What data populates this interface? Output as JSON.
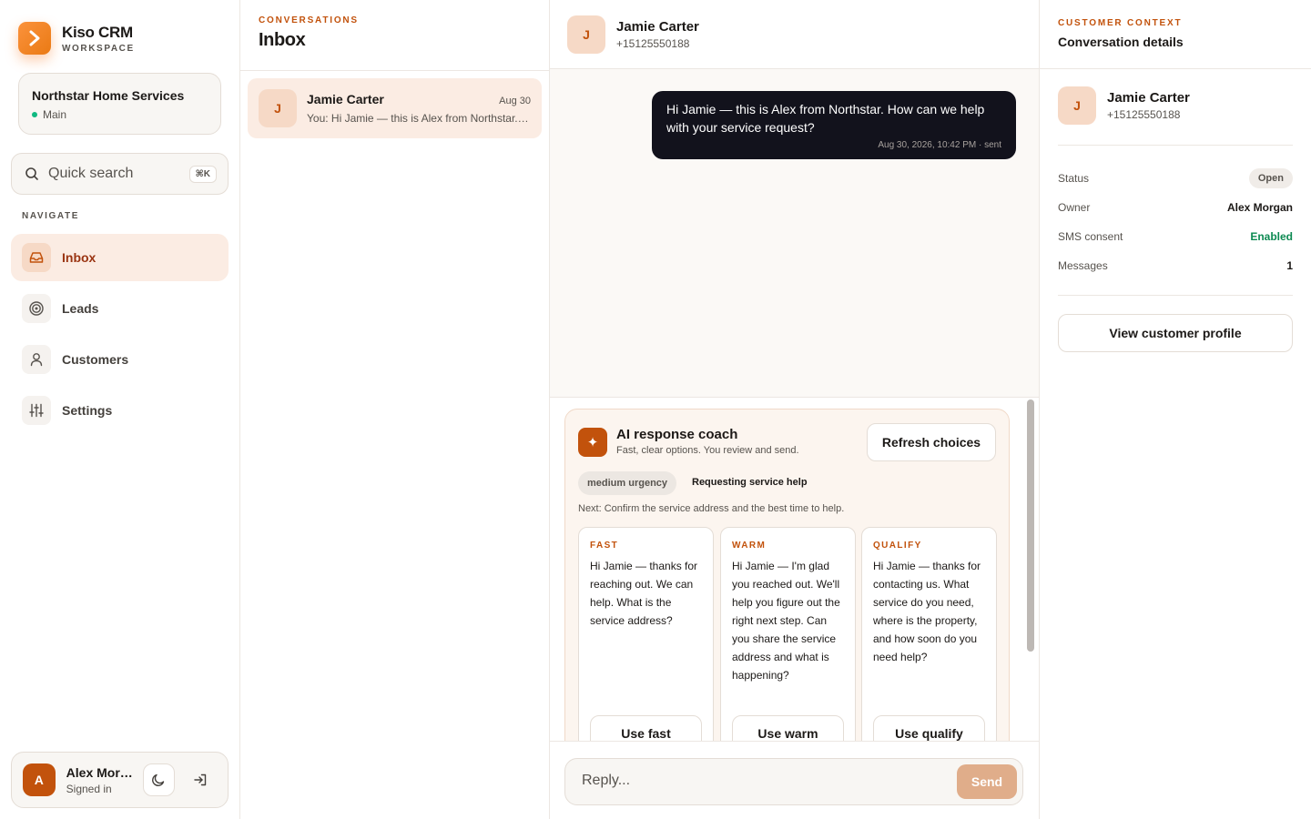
{
  "brand": {
    "name": "Kiso CRM",
    "subtitle": "WORKSPACE",
    "logo_icon": "chevron-right-icon",
    "accent": "#f97316"
  },
  "workspace": {
    "name": "Northstar Home Services",
    "environment": "Main"
  },
  "search": {
    "placeholder": "Quick search",
    "shortcut": "⌘K"
  },
  "nav": {
    "heading": "NAVIGATE",
    "items": [
      {
        "label": "Inbox",
        "icon": "inbox-icon",
        "active": true
      },
      {
        "label": "Leads",
        "icon": "target-icon",
        "active": false
      },
      {
        "label": "Customers",
        "icon": "user-icon",
        "active": false
      },
      {
        "label": "Settings",
        "icon": "sliders-icon",
        "active": false
      }
    ]
  },
  "user": {
    "initial": "A",
    "name": "Alex Morgan",
    "status": "Signed in"
  },
  "conversations": {
    "eyebrow": "CONVERSATIONS",
    "title": "Inbox",
    "items": [
      {
        "initial": "J",
        "name": "Jamie Carter",
        "date": "Aug 30",
        "preview": "You: Hi Jamie — this is Alex from Northstar. How can we help with your service request?"
      }
    ]
  },
  "thread": {
    "contact": {
      "initial": "J",
      "name": "Jamie Carter",
      "phone": "+15125550188"
    },
    "messages": [
      {
        "text": "Hi Jamie — this is Alex from Northstar. How can we help with your service request?",
        "meta": "Aug 30, 2026, 10:42 PM · sent"
      }
    ]
  },
  "coach": {
    "icon": "sparkle-icon",
    "title": "AI response coach",
    "subtitle": "Fast, clear options. You review and send.",
    "refresh_label": "Refresh choices",
    "urgency": "medium urgency",
    "intent": "Requesting service help",
    "next_step": "Next: Confirm the service address and the best time to help.",
    "choices": [
      {
        "kicker": "FAST",
        "text": "Hi Jamie — thanks for reaching out. We can help. What is the service address?",
        "button": "Use fast"
      },
      {
        "kicker": "WARM",
        "text": "Hi Jamie — I'm glad you reached out. We'll help you figure out the right next step. Can you share the service address and what is happening?",
        "button": "Use warm"
      },
      {
        "kicker": "QUALIFY",
        "text": "Hi Jamie — thanks for contacting us. What service do you need, where is the property, and how soon do you need help?",
        "button": "Use qualify"
      }
    ]
  },
  "composer": {
    "placeholder": "Reply...",
    "send_label": "Send"
  },
  "context": {
    "eyebrow": "CUSTOMER CONTEXT",
    "title": "Conversation details",
    "contact": {
      "initial": "J",
      "name": "Jamie Carter",
      "phone": "+15125550188"
    },
    "rows": [
      {
        "label": "Status",
        "value": "Open"
      },
      {
        "label": "Owner",
        "value": "Alex Morgan"
      },
      {
        "label": "SMS consent",
        "value": "Enabled"
      },
      {
        "label": "Messages",
        "value": "1"
      }
    ],
    "profile_button": "View customer profile"
  }
}
